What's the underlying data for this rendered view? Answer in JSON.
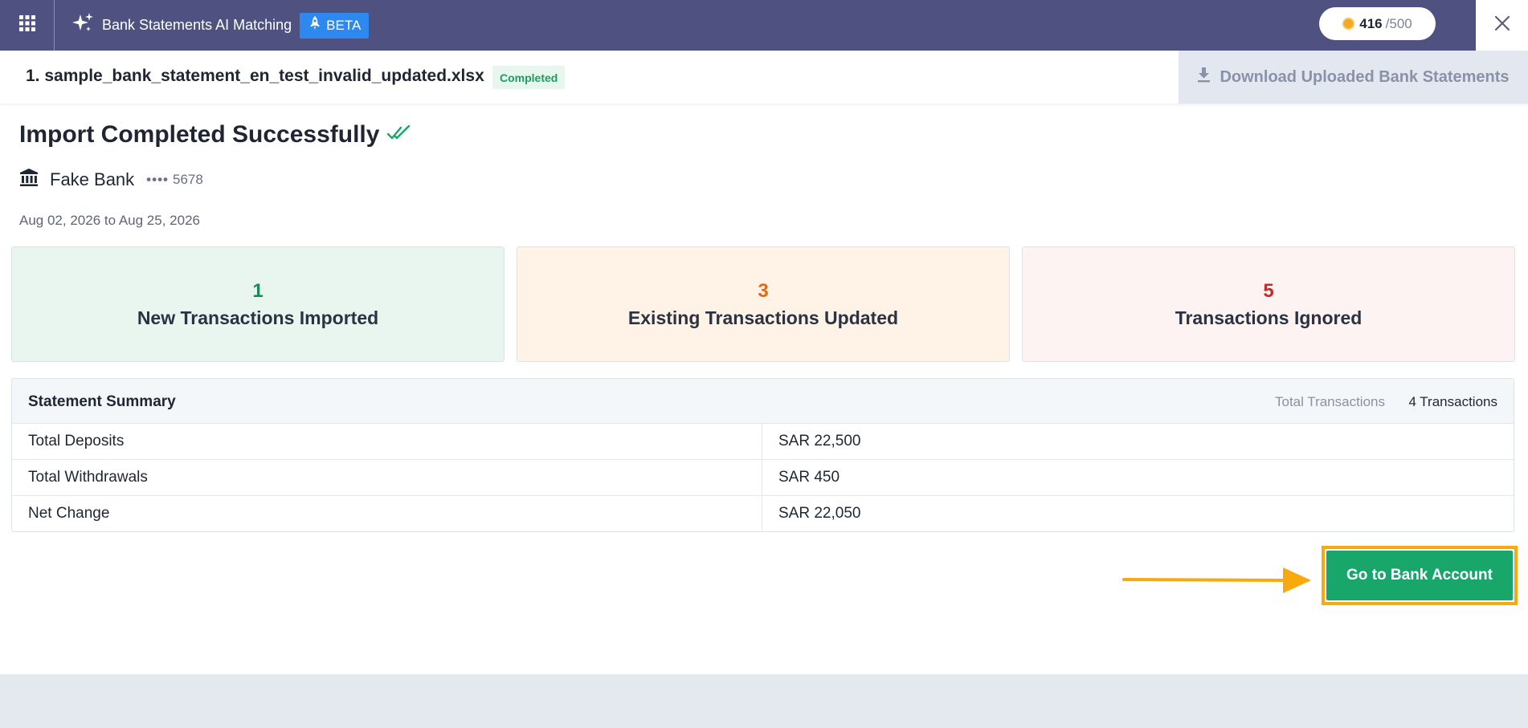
{
  "header": {
    "app_title": "Bank Statements AI Matching",
    "beta_label": "BETA",
    "credits_used": "416",
    "credits_total": "/500",
    "icons": {
      "menu": "apps-grid-icon",
      "sparkle": "sparkle-icon",
      "beta": "rocket-icon",
      "coin": "coin-icon",
      "close": "close-icon"
    }
  },
  "file": {
    "name": "1. sample_bank_statement_en_test_invalid_updated.xlsx",
    "status": "Completed",
    "download_label": "Download Uploaded Bank Statements"
  },
  "result": {
    "title": "Import Completed Successfully",
    "bank_name": "Fake Bank",
    "account_dots": "••••",
    "account_last4": "5678",
    "date_range": "Aug 02, 2026 to Aug 25, 2026"
  },
  "stats": [
    {
      "count": "1",
      "label": "New Transactions Imported",
      "color": "#1a8a56"
    },
    {
      "count": "3",
      "label": "Existing Transactions Updated",
      "color": "#e26a12"
    },
    {
      "count": "5",
      "label": "Transactions Ignored",
      "color": "#c92a2a"
    }
  ],
  "summary": {
    "title": "Statement Summary",
    "total_label": "Total Transactions",
    "total_value": "4 Transactions",
    "rows": [
      {
        "label": "Total Deposits",
        "value": "SAR 22,500"
      },
      {
        "label": "Total Withdrawals",
        "value": "SAR 450"
      },
      {
        "label": "Net Change",
        "value": "SAR 22,050"
      }
    ]
  },
  "cta": {
    "label": "Go to Bank Account",
    "accent": "#18a66a",
    "highlight": "#f7a90f"
  }
}
